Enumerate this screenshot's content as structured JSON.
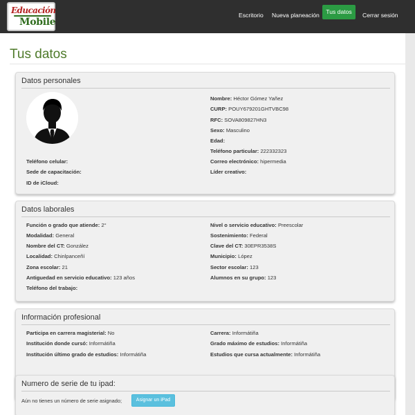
{
  "logo": {
    "line1": "Educación",
    "line2": "Mobile"
  },
  "nav": {
    "escritorio": "Escritorio",
    "nueva_planeacion": "Nueva planeación",
    "tus_datos": "Tus datos",
    "cerrar_sesion": "Cerrar sesión"
  },
  "page_title": "Tus datos",
  "personales": {
    "title": "Datos personales",
    "telefono_celular": {
      "label": "Teléfono celular:",
      "value": ""
    },
    "sede": {
      "label": "Sede de capacitación:",
      "value": ""
    },
    "icloud": {
      "label": "ID de iCloud:",
      "value": ""
    },
    "nombre": {
      "label": "Nombre:",
      "value": "Héctor Gómez Yañez"
    },
    "curp": {
      "label": "CURP:",
      "value": "POUY679201GHTVBC98"
    },
    "rfc": {
      "label": "RFC:",
      "value": "SOVA809827HN3"
    },
    "sexo": {
      "label": "Sexo:",
      "value": "Masculino"
    },
    "edad": {
      "label": "Edad:",
      "value": ""
    },
    "telefono_particular": {
      "label": "Teléfono particular:",
      "value": "222332323"
    },
    "correo": {
      "label": "Correo electrónico:",
      "value": "hipermedia"
    },
    "lider": {
      "label": "Líder creativo:",
      "value": ""
    }
  },
  "laborales": {
    "title": "Datos laborales",
    "funcion": {
      "label": "Función o grado que atiende:",
      "value": "2°"
    },
    "modalidad": {
      "label": "Modalidad:",
      "value": "General"
    },
    "nombre_ct": {
      "label": "Nombre del CT:",
      "value": "González"
    },
    "localidad": {
      "label": "Localidad:",
      "value": "Chinlpanceñí"
    },
    "zona": {
      "label": "Zona escolar:",
      "value": "21"
    },
    "antiguedad": {
      "label": "Antiguedad en servicio educativo:",
      "value": "123 años"
    },
    "telefono_trabajo": {
      "label": "Teléfono del trabajo:",
      "value": ""
    },
    "nivel": {
      "label": "Nivel o servicio educativo:",
      "value": "Preescolar"
    },
    "sostenimiento": {
      "label": "Sostenimiento:",
      "value": "Federal"
    },
    "clave_ct": {
      "label": "Clave del CT:",
      "value": "30EPR3538S"
    },
    "municipio": {
      "label": "Municipio:",
      "value": "López"
    },
    "sector": {
      "label": "Sector escolar:",
      "value": "123"
    },
    "alumnos": {
      "label": "Alumnos en su grupo:",
      "value": "123"
    }
  },
  "profesional": {
    "title": "Información profesional",
    "carrera_magisterial": {
      "label": "Participa en carrera magisterial:",
      "value": "No"
    },
    "institucion": {
      "label": "Institución donde cursó:",
      "value": "Informátiña"
    },
    "institucion_ultimo": {
      "label": "Institución último grado de estudios:",
      "value": "Informátiña"
    },
    "carrera": {
      "label": "Carrera:",
      "value": "Informátiña"
    },
    "grado_maximo": {
      "label": "Grado máximo de estudios:",
      "value": "Informátiña"
    },
    "estudios_actuales": {
      "label": "Estudios que cursa actualmente:",
      "value": "Informátiña"
    }
  },
  "ipad": {
    "title": "Numero de serie de tu ipad:",
    "message": "Aún no tienes un número de serie asignado;",
    "button": "Asignar un iPad"
  },
  "colors": {
    "brand_green": "#4e7a2a",
    "nav_active": "#2b9b43",
    "info_button": "#5bc0de",
    "navbar": "#2f2f2f"
  }
}
